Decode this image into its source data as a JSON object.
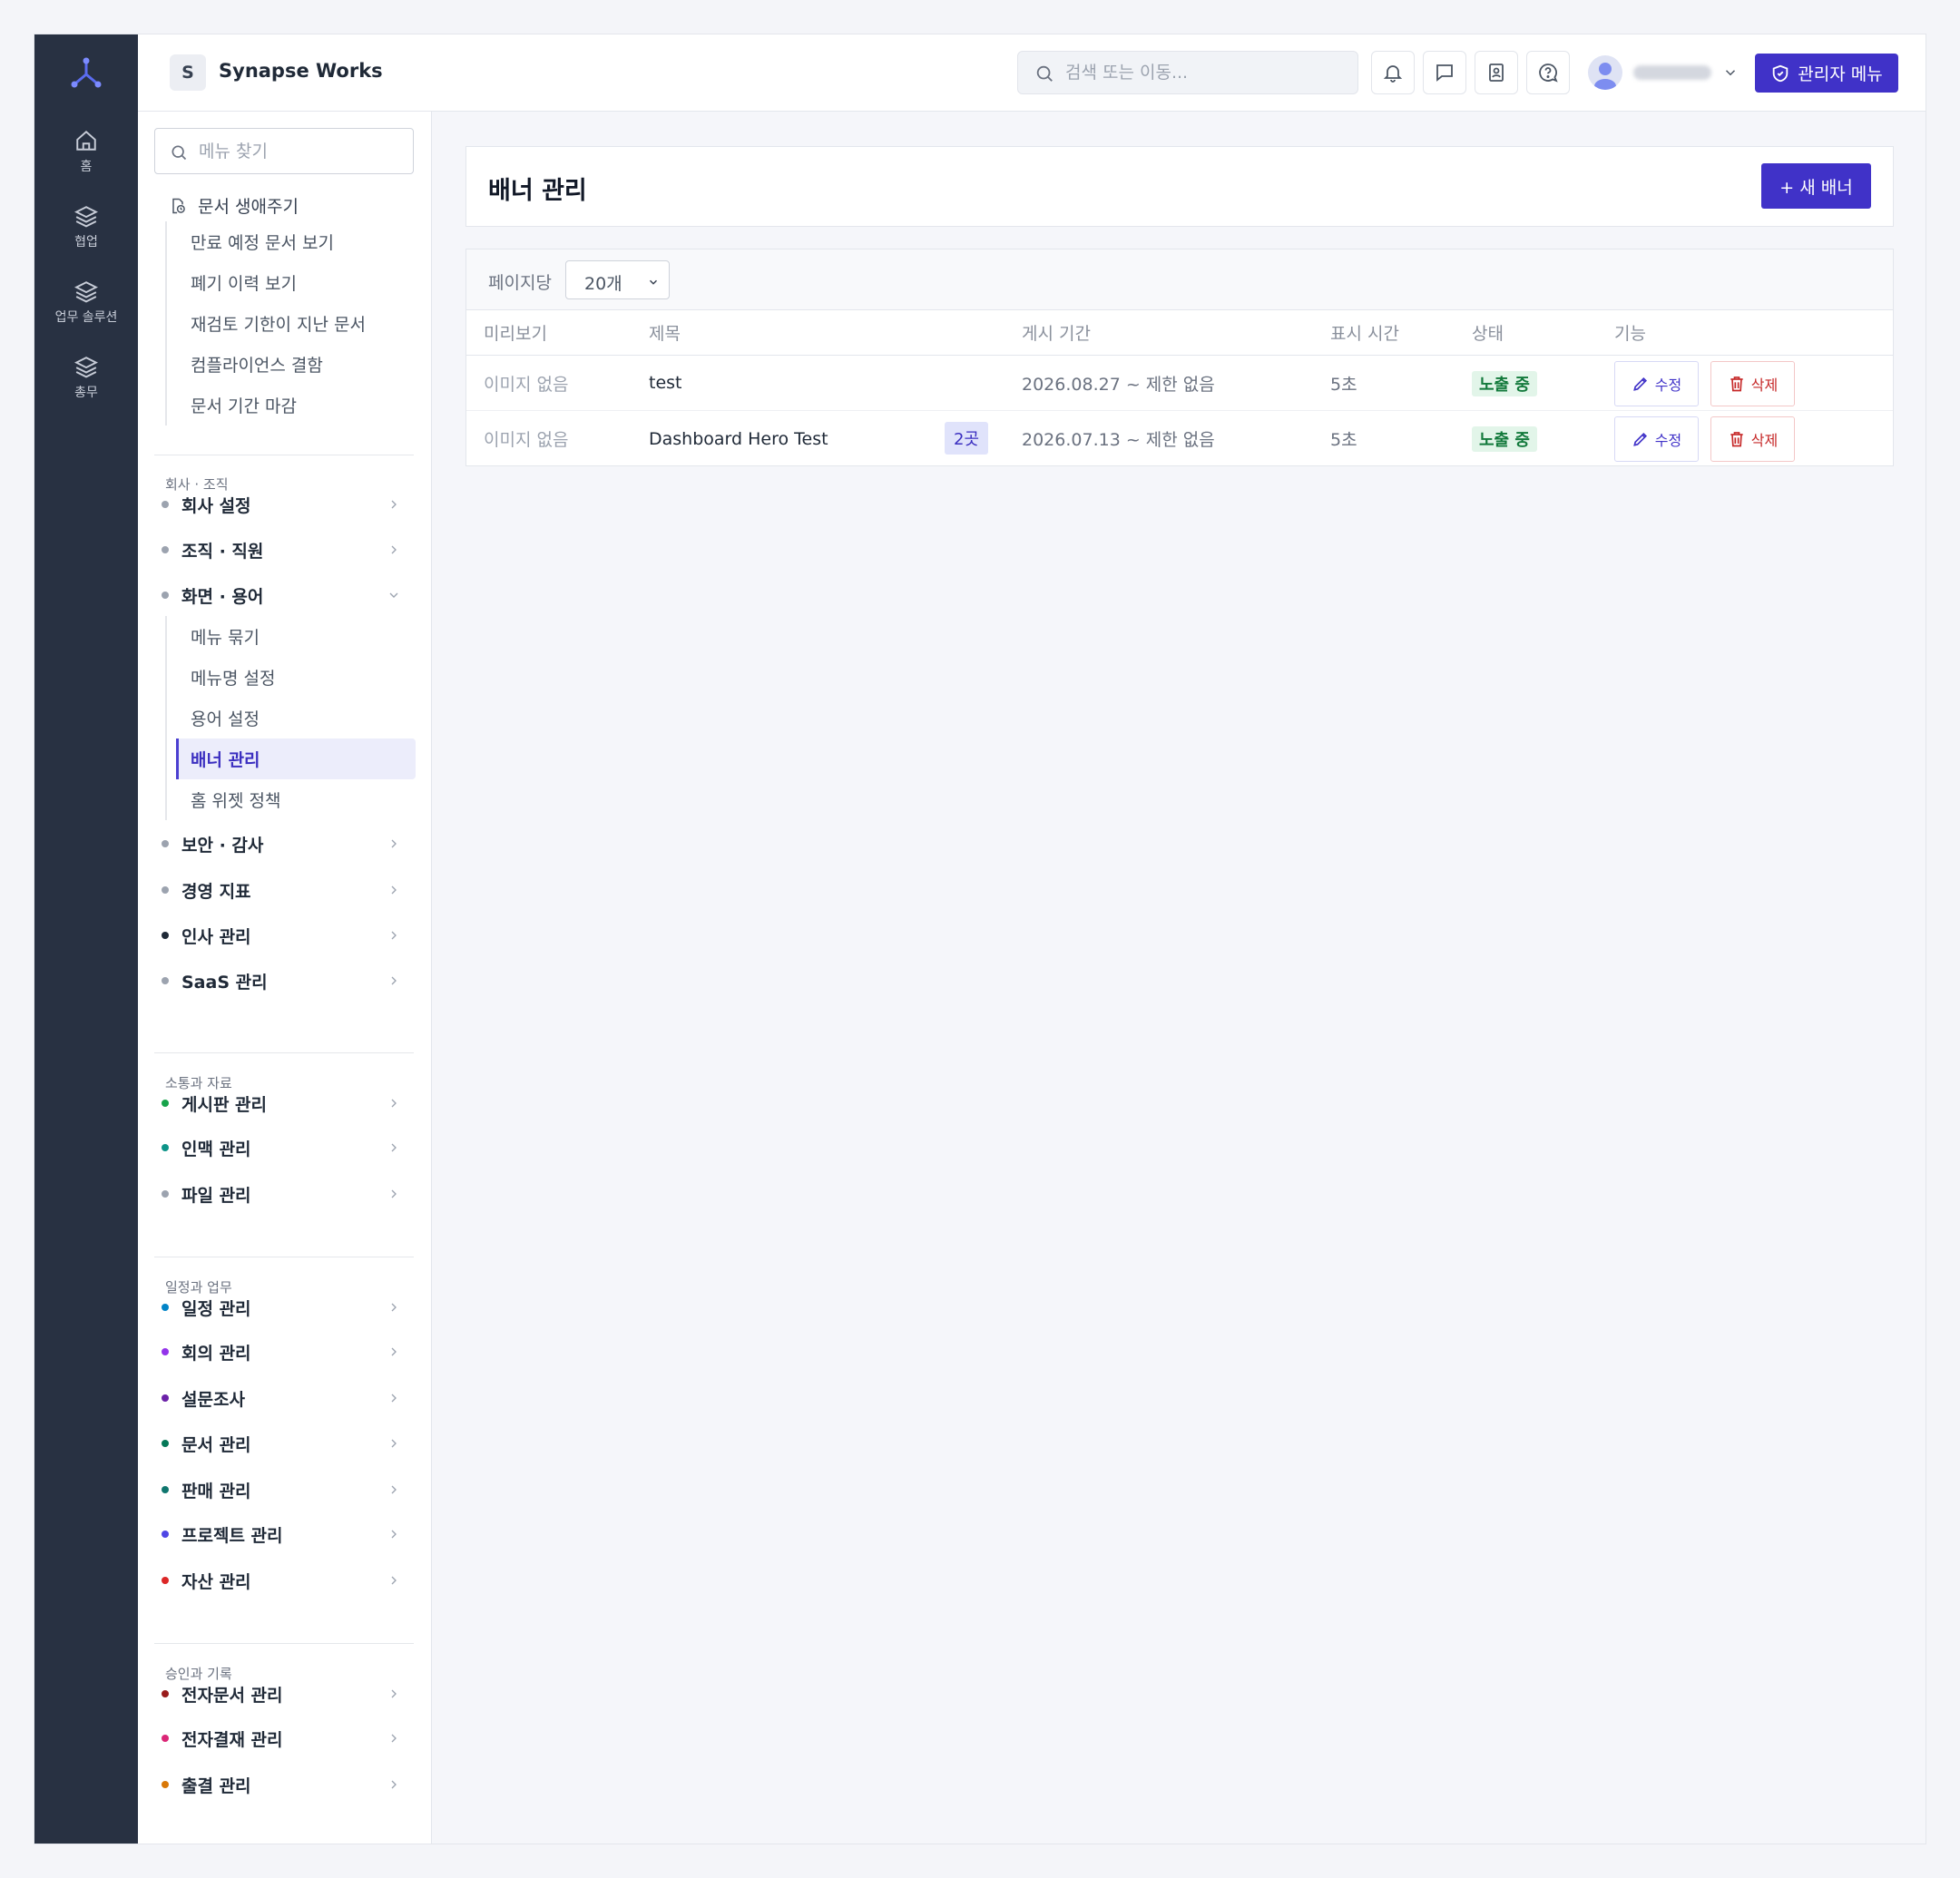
{
  "rail": [
    {
      "label": "홈",
      "icon": "home-icon"
    },
    {
      "label": "협업",
      "icon": "layers-icon"
    },
    {
      "label": "업무 솔루션",
      "icon": "layers-icon"
    },
    {
      "label": "총무",
      "icon": "layers-icon"
    }
  ],
  "header": {
    "workspace_initial": "S",
    "workspace_name": "Synapse Works",
    "search_placeholder": "검색 또는 이동...",
    "icons": [
      "bell-icon",
      "chat-icon",
      "contacts-icon",
      "help-icon"
    ],
    "admin_label": "관리자 메뉴"
  },
  "sidebar": {
    "search_placeholder": "메뉴 찾기",
    "lifecycle": {
      "label": "문서 생애주기",
      "items": [
        "만료 예정 문서 보기",
        "폐기 이력 보기",
        "재검토 기한이 지난 문서",
        "컴플라이언스 결함",
        "문서 기간 마감"
      ]
    },
    "sections": [
      {
        "label": "회사 · 조직",
        "items": [
          {
            "label": "회사 설정",
            "dot": "#9ca3af"
          },
          {
            "label": "조직 · 직원",
            "dot": "#9ca3af"
          },
          {
            "label": "화면 · 용어",
            "dot": "#9ca3af",
            "expanded": true,
            "children": [
              "메뉴 묶기",
              "메뉴명 설정",
              "용어 설정",
              "배너 관리",
              "홈 위젯 정책"
            ]
          },
          {
            "label": "보안 · 감사",
            "dot": "#9ca3af"
          },
          {
            "label": "경영 지표",
            "dot": "#9ca3af"
          },
          {
            "label": "인사 관리",
            "dot": "#1f2937"
          },
          {
            "label": "SaaS 관리",
            "dot": "#9ca3af"
          }
        ]
      },
      {
        "label": "소통과 자료",
        "items": [
          {
            "label": "게시판 관리",
            "dot": "#16a34a"
          },
          {
            "label": "인맥 관리",
            "dot": "#0d9488"
          },
          {
            "label": "파일 관리",
            "dot": "#9ca3af"
          }
        ]
      },
      {
        "label": "일정과 업무",
        "items": [
          {
            "label": "일정 관리",
            "dot": "#0284c7"
          },
          {
            "label": "회의 관리",
            "dot": "#9333ea"
          },
          {
            "label": "설문조사",
            "dot": "#6b21a8"
          },
          {
            "label": "문서 관리",
            "dot": "#047857"
          },
          {
            "label": "판매 관리",
            "dot": "#0f766e"
          },
          {
            "label": "프로젝트 관리",
            "dot": "#4f46e5"
          },
          {
            "label": "자산 관리",
            "dot": "#dc2626"
          }
        ]
      },
      {
        "label": "승인과 기록",
        "items": [
          {
            "label": "전자문서 관리",
            "dot": "#991b1b"
          },
          {
            "label": "전자결재 관리",
            "dot": "#db2777"
          },
          {
            "label": "출결 관리",
            "dot": "#d97706"
          }
        ]
      }
    ],
    "active_child": "배너 관리"
  },
  "main": {
    "title": "배너 관리",
    "new_button": "+ 새 배너",
    "per_page_label": "페이지당",
    "per_page_value": "20개",
    "columns": [
      "미리보기",
      "제목",
      "게시 기간",
      "표시 시간",
      "상태",
      "기능"
    ],
    "rows": [
      {
        "preview": "이미지 없음",
        "title": "test",
        "badge": "",
        "period": "2026.08.27 ~ 제한 없음",
        "duration": "5초",
        "status": "노출 중",
        "edit": "수정",
        "delete": "삭제"
      },
      {
        "preview": "이미지 없음",
        "title": "Dashboard Hero Test",
        "badge": "2곳",
        "period": "2026.07.13 ~ 제한 없음",
        "duration": "5초",
        "status": "노출 중",
        "edit": "수정",
        "delete": "삭제"
      }
    ]
  },
  "colors": {
    "accent": "#4032c8",
    "rail": "#283142",
    "status_bg": "#e2f5e9",
    "status_text": "#137a3c",
    "danger": "#c62828"
  }
}
